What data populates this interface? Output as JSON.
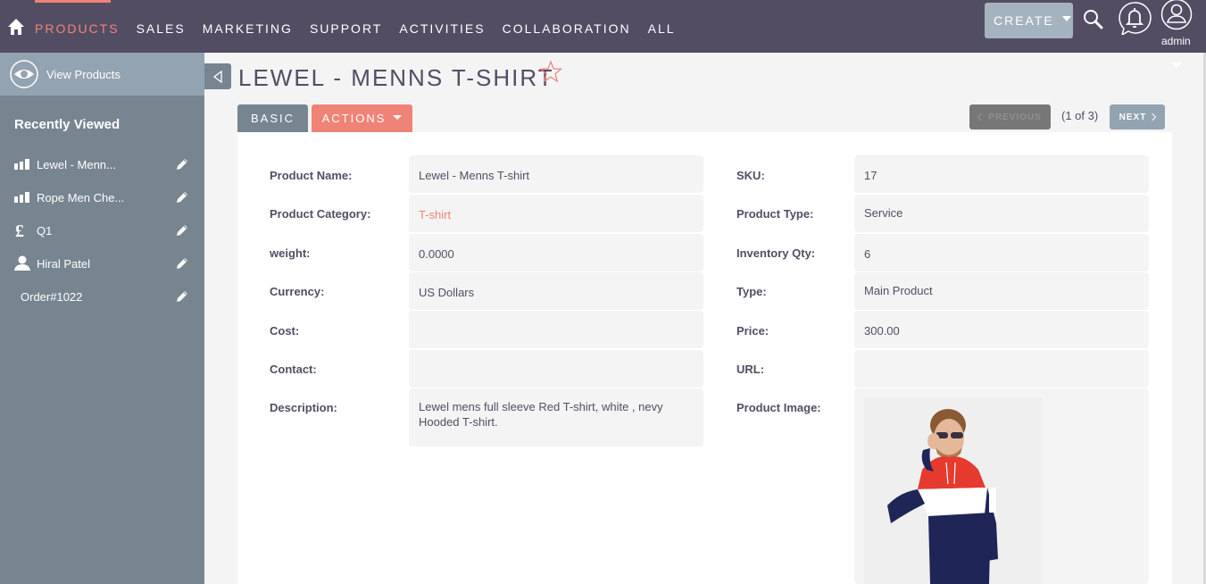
{
  "topnav": {
    "items": [
      {
        "label": "PRODUCTS",
        "active": true
      },
      {
        "label": "SALES"
      },
      {
        "label": "MARKETING"
      },
      {
        "label": "SUPPORT"
      },
      {
        "label": "ACTIVITIES"
      },
      {
        "label": "COLLABORATION"
      },
      {
        "label": "ALL"
      }
    ],
    "create_label": "CREATE",
    "user_label": "admin"
  },
  "sidebar": {
    "view_products_label": "View Products",
    "recent_title": "Recently Viewed",
    "recent_items": [
      {
        "icon": "products-bars-icon",
        "label": "Lewel - Menn..."
      },
      {
        "icon": "products-bars-icon",
        "label": "Rope Men Che..."
      },
      {
        "icon": "pound-icon",
        "label": "Q1"
      },
      {
        "icon": "person-icon",
        "label": "Hiral Patel"
      },
      {
        "icon": "",
        "label": "Order#1022"
      }
    ]
  },
  "record": {
    "title": "LEWEL - MENNS T-SHIRT",
    "tabs": {
      "basic": "BASIC",
      "actions": "ACTIONS"
    },
    "pagination": {
      "previous": "PREVIOUS",
      "count": "(1 of 3)",
      "next": "NEXT"
    },
    "left_fields": [
      {
        "label": "Product Name:",
        "value": "Lewel - Menns T-shirt"
      },
      {
        "label": "Product Category:",
        "value": "T-shirt",
        "link": true
      },
      {
        "label": "weight:",
        "value": "0.0000"
      },
      {
        "label": "Currency:",
        "value": "US Dollars"
      },
      {
        "label": "Cost:",
        "value": ""
      },
      {
        "label": "Contact:",
        "value": ""
      },
      {
        "label": "Description:",
        "value": "Lewel mens full sleeve Red T-shirt, white , nevy Hooded T-shirt."
      }
    ],
    "right_fields": [
      {
        "label": "SKU:",
        "value": "17"
      },
      {
        "label": "Product Type:",
        "value": "Service"
      },
      {
        "label": "Inventory Qty:",
        "value": "6"
      },
      {
        "label": "Type:",
        "value": "Main Product"
      },
      {
        "label": "Price:",
        "value": "300.00"
      },
      {
        "label": "URL:",
        "value": ""
      },
      {
        "label": "Product Image:",
        "value": ""
      }
    ]
  },
  "colors": {
    "nav_bg": "#534d64",
    "accent": "#f08377",
    "sidebar_bg": "#778591",
    "sidebar_highlight": "#94a3b1"
  }
}
